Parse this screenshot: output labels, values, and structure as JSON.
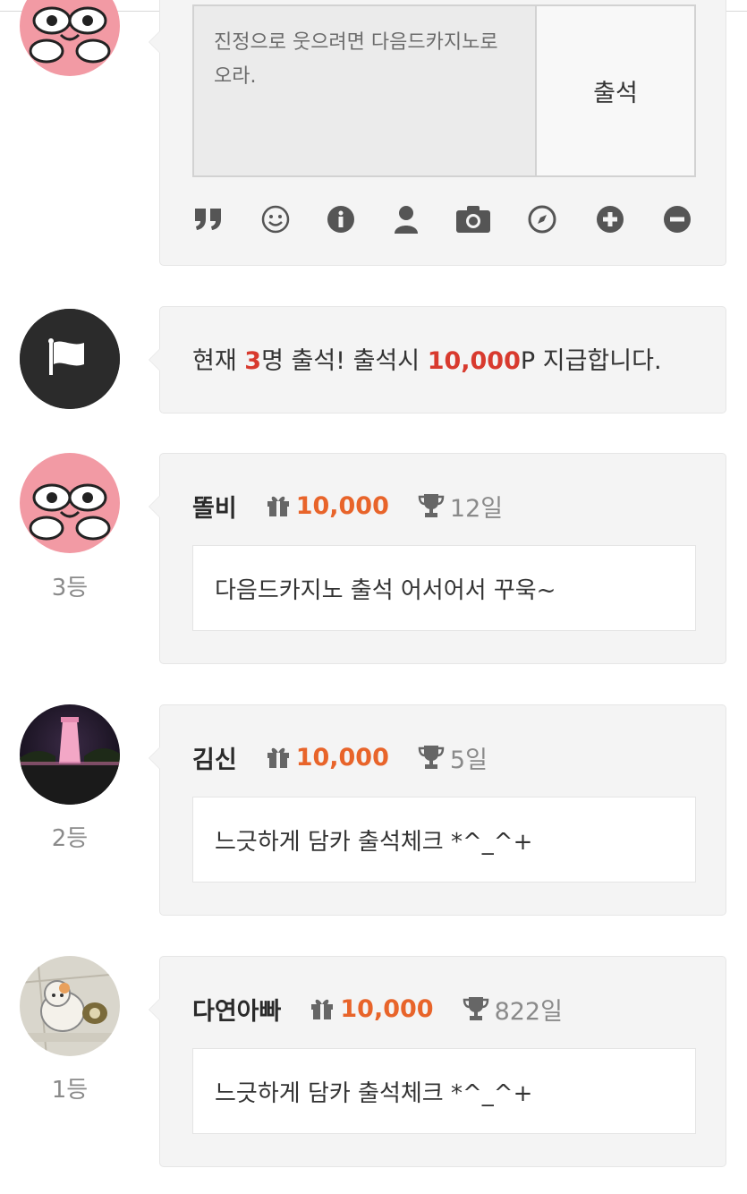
{
  "colors": {
    "accent_red": "#d83a2e",
    "points_orange": "#e8642a",
    "card_bg": "#f4f4f4",
    "muted": "#8a8a8a"
  },
  "composer": {
    "text": "진정으로 웃으려면 다음드카지노로 오라.",
    "submit_label": "출석",
    "toolbar_icons": [
      "quote-icon",
      "smiley-icon",
      "info-icon",
      "user-icon",
      "camera-icon",
      "compass-icon",
      "plus-circle-icon",
      "minus-circle-icon"
    ]
  },
  "notice": {
    "icon": "flag-icon",
    "pre": "현재 ",
    "count": "3",
    "mid": "명 출석! 출석시 ",
    "points": "10,000",
    "post": "P 지급합니다."
  },
  "comments": [
    {
      "rank": "3등",
      "name": "똘비",
      "points": "10,000",
      "days": "12일",
      "text": "다음드카지노 출석 어서어서 꾸욱~"
    },
    {
      "rank": "2등",
      "name": "김신",
      "points": "10,000",
      "days": "5일",
      "text": "느긋하게 담카 출석체크 *^_^+"
    },
    {
      "rank": "1등",
      "name": "다연아빠",
      "points": "10,000",
      "days": "822일",
      "text": "느긋하게 담카 출석체크 *^_^+"
    }
  ]
}
